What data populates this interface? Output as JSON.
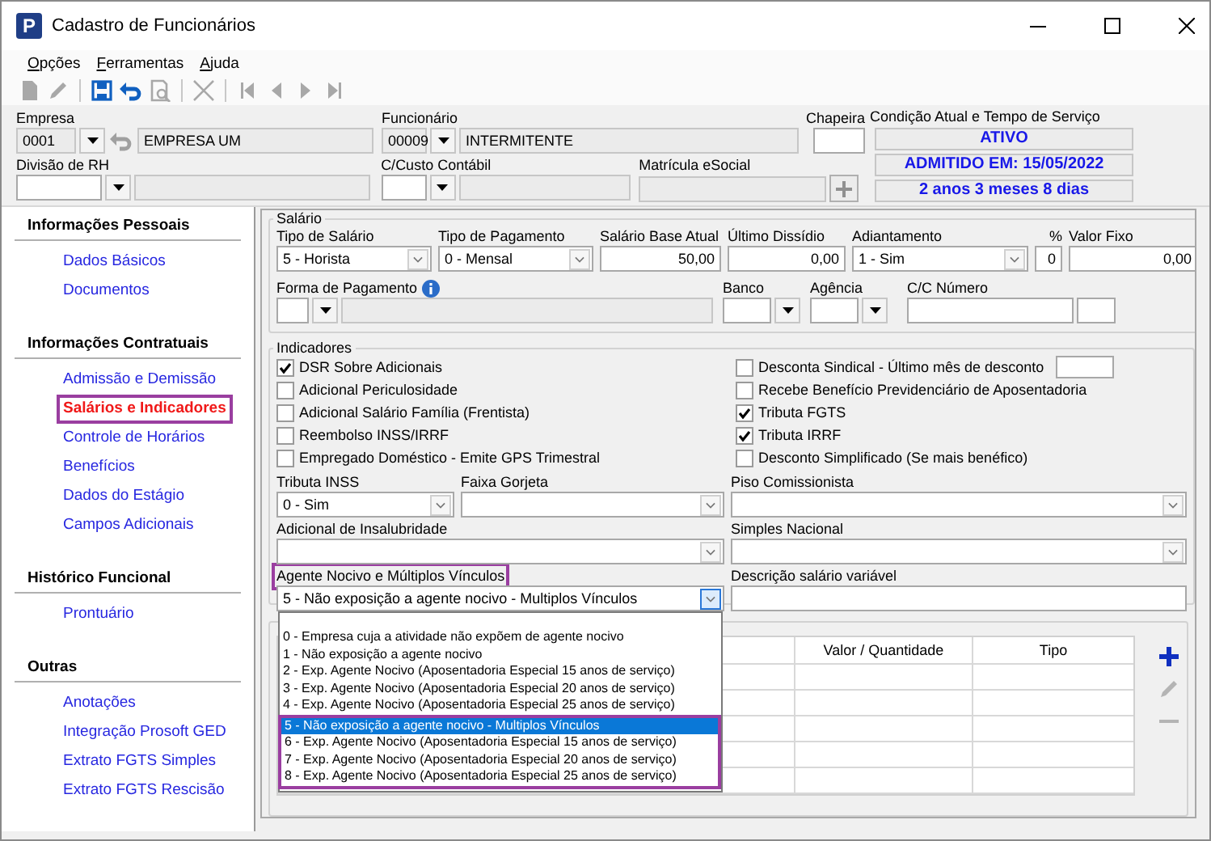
{
  "window": {
    "title": "Cadastro de Funcionários",
    "logo_text": "P"
  },
  "menu": [
    {
      "label": "Opções"
    },
    {
      "label": "Ferramentas"
    },
    {
      "label": "Ajuda"
    }
  ],
  "toolbar": {
    "groups": [
      {
        "tools": [
          {
            "kind": "new",
            "disabled": true
          },
          {
            "kind": "edit",
            "disabled": true
          }
        ]
      },
      {
        "tools": [
          {
            "kind": "save",
            "disabled": false
          },
          {
            "kind": "undo",
            "disabled": false
          },
          {
            "kind": "preview",
            "disabled": true
          }
        ]
      },
      {
        "tools": [
          {
            "kind": "delete",
            "disabled": true
          }
        ]
      },
      {
        "tools": [
          {
            "kind": "first",
            "disabled": true
          },
          {
            "kind": "previous",
            "disabled": true
          },
          {
            "kind": "next",
            "disabled": true
          },
          {
            "kind": "last",
            "disabled": true
          }
        ]
      }
    ]
  },
  "header": {
    "empresa": {
      "label": "Empresa",
      "code": "0001",
      "name": "EMPRESA UM"
    },
    "funcionario": {
      "label": "Funcionário",
      "code": "00009",
      "name": "INTERMITENTE"
    },
    "chapeira": {
      "label": "Chapeira"
    },
    "divisao_rh": {
      "label": "Divisão de RH"
    },
    "custo_contabil": {
      "label": "C/Custo Contábil"
    },
    "matricula_esocial": {
      "label": "Matrícula eSocial"
    },
    "condicao": {
      "label": "Condição Atual e Tempo de Serviço",
      "lines": [
        "ATIVO",
        "ADMITIDO EM: 15/05/2022",
        "2 anos 3 meses 8 dias"
      ]
    }
  },
  "sidebar": {
    "sections": [
      {
        "title": "Informações Pessoais",
        "items": [
          {
            "label": "Dados Básicos",
            "selected": false,
            "highlighted": false
          },
          {
            "label": "Documentos",
            "selected": false,
            "highlighted": false
          }
        ]
      },
      {
        "title": "Informações Contratuais",
        "items": [
          {
            "label": "Admissão e Demissão",
            "selected": false,
            "highlighted": false
          },
          {
            "label": "Salários e Indicadores",
            "selected": true,
            "highlighted": true
          },
          {
            "label": "Controle de Horários",
            "selected": false,
            "highlighted": false
          },
          {
            "label": "Benefícios",
            "selected": false,
            "highlighted": false
          },
          {
            "label": "Dados do Estágio",
            "selected": false,
            "highlighted": false
          },
          {
            "label": "Campos Adicionais",
            "selected": false,
            "highlighted": false
          }
        ]
      },
      {
        "title": "Histórico Funcional",
        "items": [
          {
            "label": "Prontuário",
            "selected": false,
            "highlighted": false
          }
        ]
      },
      {
        "title": "Outras",
        "items": [
          {
            "label": "Anotações",
            "selected": false,
            "highlighted": false
          },
          {
            "label": "Integração Prosoft GED",
            "selected": false,
            "highlighted": false
          },
          {
            "label": "Extrato FGTS Simples",
            "selected": false,
            "highlighted": false
          },
          {
            "label": "Extrato FGTS Rescisão",
            "selected": false,
            "highlighted": false
          }
        ]
      }
    ]
  },
  "salario": {
    "title": "Salário",
    "row_1": [
      {
        "label": "Tipo de Salário",
        "kind": "combo",
        "value": "5 - Horista"
      },
      {
        "label": "Tipo de Pagamento",
        "kind": "combo",
        "value": "0 - Mensal"
      },
      {
        "label": "Salário Base Atual",
        "kind": "number",
        "value": "50,00"
      },
      {
        "label": "Último Dissídio",
        "kind": "number",
        "value": "0,00"
      },
      {
        "label": "Adiantamento",
        "kind": "combo",
        "value": "1 - Sim"
      },
      {
        "label": "%",
        "kind": "number",
        "value": "0"
      },
      {
        "label": "Valor Fixo",
        "kind": "number",
        "value": "0,00"
      }
    ],
    "row_2": [
      {
        "label": "Forma de Pagamento",
        "kind": "lookup",
        "info": true
      },
      {
        "label": "Banco",
        "kind": "short_lookup"
      },
      {
        "label": "Agência",
        "kind": "short_lookup"
      },
      {
        "label": "C/C Número",
        "kind": "account"
      }
    ]
  },
  "indicadores": {
    "title": "Indicadores",
    "left_checks": [
      {
        "label": "DSR Sobre Adicionais",
        "checked": true,
        "kind": "check"
      },
      {
        "label": "Adicional Periculosidade",
        "checked": false,
        "kind": "check"
      },
      {
        "label": "Adicional Salário Família (Frentista)",
        "checked": false,
        "kind": "check"
      },
      {
        "label": "Reembolso INSS/IRRF",
        "checked": false,
        "kind": "check"
      },
      {
        "label": "Empregado Doméstico - Emite GPS Trimestral",
        "checked": false,
        "kind": "check"
      }
    ],
    "right_checks": [
      {
        "label": "Desconta Sindical - Último mês de desconto",
        "checked": false,
        "kind": "check_field"
      },
      {
        "label": "Recebe Benefício Previdenciário de Aposentadoria",
        "checked": false,
        "kind": "check"
      },
      {
        "label": "Tributa FGTS",
        "checked": true,
        "kind": "check"
      },
      {
        "label": "Tributa IRRF",
        "checked": true,
        "kind": "check"
      },
      {
        "label": "Desconto Simplificado (Se mais benéfico)",
        "checked": false,
        "kind": "check"
      }
    ],
    "row_1": [
      {
        "label": "Tributa INSS",
        "kind": "combo",
        "value": "0 - Sim"
      },
      {
        "label": "Faixa Gorjeta",
        "kind": "combo"
      },
      {
        "label": "Piso Comissionista",
        "kind": "combo"
      }
    ],
    "row_2": [
      {
        "label": "Adicional de Insalubridade",
        "kind": "combo"
      },
      {
        "label": "Simples Nacional",
        "kind": "combo"
      }
    ],
    "row_3": [
      {
        "label": "Agente Nocivo e  Múltiplos Vínculos",
        "kind": "combo",
        "value": "5 - Não exposição a agente nocivo - Multiplos Vínculos",
        "expanded": true,
        "highlighted": true,
        "options": [
          {
            "label": "0 - Empresa cuja a atividade não expõem de agente nocivo",
            "selected": false,
            "highlighted": false
          },
          {
            "label": "1 - Não exposição a agente nocivo",
            "selected": false,
            "highlighted": false
          },
          {
            "label": "2 - Exp. Agente Nocivo (Aposentadoria Especial 15 anos de serviço)",
            "selected": false,
            "highlighted": false
          },
          {
            "label": "3 - Exp. Agente Nocivo (Aposentadoria Especial 20 anos de serviço)",
            "selected": false,
            "highlighted": false
          },
          {
            "label": "4 - Exp. Agente Nocivo (Aposentadoria Especial 25 anos de serviço)",
            "selected": false,
            "highlighted": false
          },
          {
            "label": "5 - Não exposição a agente nocivo - Multiplos Vínculos",
            "selected": true,
            "highlighted": true
          },
          {
            "label": "6 - Exp. Agente Nocivo (Aposentadoria Especial 15 anos de serviço)",
            "selected": false,
            "highlighted": true
          },
          {
            "label": "7 - Exp. Agente Nocivo (Aposentadoria Especial 20 anos de serviço)",
            "selected": false,
            "highlighted": true
          },
          {
            "label": "8 - Exp. Agente Nocivo (Aposentadoria Especial 25 anos de serviço)",
            "selected": false,
            "highlighted": true
          }
        ]
      },
      {
        "label": "Descrição salário variável",
        "kind": "text"
      }
    ]
  },
  "table": {
    "columns": [
      {
        "label": "Valor / Quantidade"
      },
      {
        "label": "Tipo"
      }
    ],
    "actions": [
      {
        "kind": "add",
        "disabled": false
      },
      {
        "kind": "edit",
        "disabled": true
      },
      {
        "kind": "remove",
        "disabled": true
      }
    ]
  }
}
